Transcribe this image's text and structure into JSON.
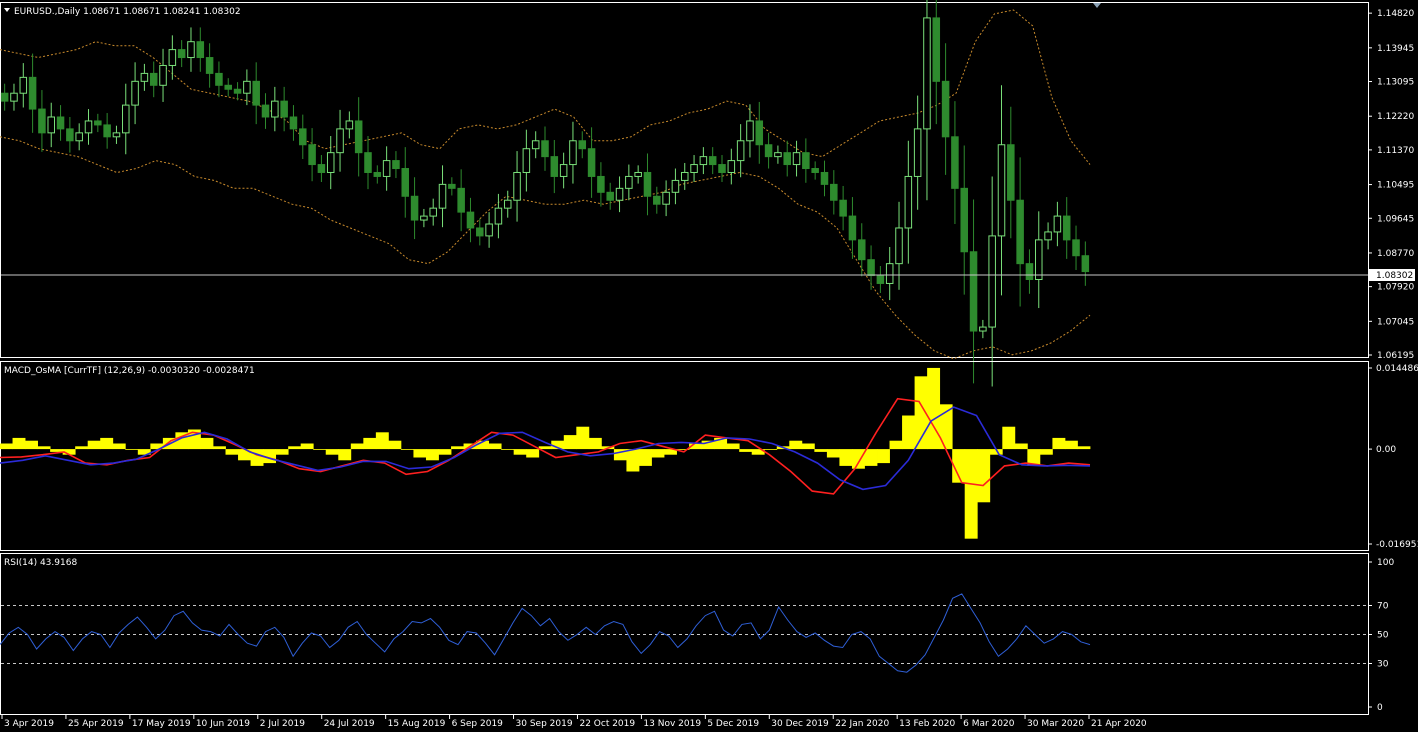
{
  "colors": {
    "background": "#000000",
    "bull": "#7ae07a",
    "bear": "#2e8b2e",
    "bands": "#c88a2c",
    "histogram": "#ffff00",
    "macd_line": "#ff2020",
    "signal_line": "#2b2bd8",
    "rsi_line": "#2f5fd6",
    "frame": "#ffffff"
  },
  "panels": {
    "price": {
      "title": "EURUSD.,Daily  1.08671 1.08671 1.08241 1.08302",
      "menu_icon": "triangle-down-icon",
      "current_price": "1.08302",
      "axis_labels": [
        "1.14820",
        "1.13945",
        "1.13095",
        "1.12220",
        "1.11370",
        "1.10495",
        "1.09645",
        "1.08770",
        "1.07920",
        "1.07045",
        "1.06195"
      ]
    },
    "macd": {
      "title": "MACD_OsMA [CurrTF] (12,26,9) -0.0030320 -0.0028471",
      "axis_labels": [
        "0.0144868",
        "0.00",
        "-0.016951"
      ]
    },
    "rsi": {
      "title": "RSI(14) 43.9168",
      "axis_labels": [
        "100",
        "70",
        "50",
        "30",
        "0"
      ]
    }
  },
  "time_axis": [
    "3 Apr 2019",
    "25 Apr 2019",
    "17 May 2019",
    "10 Jun 2019",
    "2 Jul 2019",
    "24 Jul 2019",
    "15 Aug 2019",
    "6 Sep 2019",
    "30 Sep 2019",
    "22 Oct 2019",
    "13 Nov 2019",
    "5 Dec 2019",
    "30 Dec 2019",
    "22 Jan 2020",
    "13 Feb 2020",
    "6 Mar 2020",
    "30 Mar 2020",
    "21 Apr 2020"
  ],
  "chart_data": [
    {
      "type": "candlestick",
      "title": "EURUSD.,Daily",
      "instrument": "EURUSD.",
      "timeframe": "Daily",
      "last_bar": {
        "open": 1.08671,
        "high": 1.08671,
        "low": 1.08241,
        "close": 1.08302
      },
      "ylim": [
        1.0617,
        1.1495
      ],
      "closes": [
        1.126,
        1.128,
        1.132,
        1.124,
        1.118,
        1.122,
        1.119,
        1.116,
        1.118,
        1.121,
        1.12,
        1.117,
        1.118,
        1.125,
        1.131,
        1.133,
        1.13,
        1.135,
        1.139,
        1.137,
        1.141,
        1.137,
        1.133,
        1.13,
        1.129,
        1.128,
        1.131,
        1.125,
        1.122,
        1.126,
        1.122,
        1.119,
        1.115,
        1.11,
        1.108,
        1.113,
        1.119,
        1.121,
        1.113,
        1.108,
        1.107,
        1.111,
        1.109,
        1.102,
        1.096,
        1.097,
        1.099,
        1.105,
        1.104,
        1.098,
        1.094,
        1.092,
        1.095,
        1.099,
        1.101,
        1.108,
        1.114,
        1.116,
        1.112,
        1.107,
        1.11,
        1.116,
        1.114,
        1.107,
        1.103,
        1.101,
        1.104,
        1.107,
        1.108,
        1.102,
        1.1,
        1.103,
        1.106,
        1.108,
        1.11,
        1.112,
        1.11,
        1.108,
        1.111,
        1.116,
        1.121,
        1.115,
        1.112,
        1.113,
        1.11,
        1.113,
        1.109,
        1.108,
        1.105,
        1.101,
        1.097,
        1.091,
        1.086,
        1.082,
        1.08,
        1.085,
        1.094,
        1.107,
        1.119,
        1.147,
        1.131,
        1.117,
        1.104,
        1.088,
        1.068,
        1.069,
        1.092,
        1.115,
        1.101,
        1.085,
        1.081,
        1.091,
        1.093,
        1.097,
        1.091,
        1.087,
        1.083
      ],
      "upper_band": [
        1.139,
        1.138,
        1.137,
        1.138,
        1.139,
        1.141,
        1.14,
        1.14,
        1.137,
        1.133,
        1.129,
        1.128,
        1.127,
        1.126,
        1.124,
        1.121,
        1.116,
        1.114,
        1.115,
        1.116,
        1.117,
        1.118,
        1.115,
        1.114,
        1.119,
        1.12,
        1.119,
        1.12,
        1.122,
        1.124,
        1.122,
        1.116,
        1.116,
        1.117,
        1.12,
        1.121,
        1.123,
        1.124,
        1.126,
        1.125,
        1.119,
        1.116,
        1.113,
        1.112,
        1.115,
        1.118,
        1.121,
        1.122,
        1.123,
        1.125,
        1.128,
        1.141,
        1.148,
        1.149,
        1.145,
        1.127,
        1.116,
        1.11
      ],
      "lower_band": [
        1.117,
        1.116,
        1.114,
        1.113,
        1.112,
        1.11,
        1.108,
        1.109,
        1.111,
        1.11,
        1.107,
        1.106,
        1.104,
        1.104,
        1.102,
        1.1,
        1.099,
        1.096,
        1.094,
        1.092,
        1.09,
        1.086,
        1.085,
        1.088,
        1.093,
        1.098,
        1.102,
        1.101,
        1.1,
        1.1,
        1.101,
        1.1,
        1.101,
        1.102,
        1.103,
        1.105,
        1.106,
        1.107,
        1.108,
        1.107,
        1.104,
        1.1,
        1.098,
        1.094,
        1.086,
        1.078,
        1.072,
        1.067,
        1.063,
        1.061,
        1.063,
        1.064,
        1.062,
        1.063,
        1.065,
        1.068,
        1.072
      ]
    },
    {
      "type": "histogram_with_lines",
      "title": "MACD_OsMA [CurrTF] (12,26,9)",
      "values_shown": [
        -0.003032,
        -0.0028471
      ],
      "ylim": [
        -0.016951,
        0.0144868
      ],
      "histogram": [
        0.001,
        0.002,
        0.0015,
        0.0005,
        -0.0005,
        -0.001,
        0.0005,
        0.0015,
        0.002,
        0.001,
        0.0,
        -0.001,
        0.001,
        0.002,
        0.003,
        0.0035,
        0.002,
        0.0005,
        -0.001,
        -0.002,
        -0.003,
        -0.0025,
        -0.001,
        0.0005,
        0.001,
        0.0,
        -0.001,
        -0.002,
        0.001,
        0.002,
        0.003,
        0.0015,
        0.0,
        -0.0015,
        -0.002,
        -0.001,
        0.0005,
        0.001,
        0.0015,
        0.001,
        0.0,
        -0.001,
        -0.0015,
        0.0005,
        0.0015,
        0.0025,
        0.004,
        0.002,
        0.0005,
        -0.002,
        -0.004,
        -0.003,
        -0.0015,
        -0.001,
        0.0,
        0.001,
        0.0015,
        0.002,
        0.001,
        -0.0005,
        -0.001,
        0.0,
        0.0005,
        0.0015,
        0.001,
        -0.0005,
        -0.0015,
        -0.003,
        -0.0035,
        -0.003,
        -0.0025,
        0.0015,
        0.006,
        0.013,
        0.0145,
        0.008,
        -0.006,
        -0.016,
        -0.0095,
        -0.001,
        0.004,
        0.001,
        -0.003,
        -0.001,
        0.002,
        0.0015,
        0.0005
      ],
      "macd": [
        -0.0015,
        -0.0014,
        -0.001,
        -0.0005,
        -0.0025,
        -0.0028,
        -0.002,
        -0.0015,
        0.0015,
        0.003,
        0.0025,
        0.0008,
        -0.001,
        -0.002,
        -0.0035,
        -0.004,
        -0.003,
        -0.002,
        -0.0025,
        -0.0045,
        -0.004,
        -0.002,
        0.0005,
        0.003,
        0.0025,
        0.0005,
        -0.0015,
        -0.001,
        -0.0005,
        0.001,
        0.0015,
        0.0005,
        -0.0005,
        0.0025,
        0.002,
        0.0015,
        -0.001,
        -0.004,
        -0.0075,
        -0.008,
        -0.0035,
        0.003,
        0.009,
        0.0085,
        0.002,
        -0.006,
        -0.0065,
        -0.003,
        -0.0025,
        -0.003,
        -0.0025,
        -0.0028
      ],
      "signal": [
        -0.0025,
        -0.002,
        -0.0012,
        -0.002,
        -0.0028,
        -0.0025,
        -0.0018,
        0.0,
        0.002,
        0.003,
        0.0018,
        -0.0005,
        -0.0018,
        -0.0028,
        -0.0038,
        -0.0032,
        -0.0022,
        -0.0022,
        -0.0035,
        -0.0032,
        -0.0015,
        0.0008,
        0.0028,
        0.003,
        0.0012,
        -0.0005,
        -0.0012,
        -0.0008,
        0.0,
        0.001,
        0.0012,
        0.001,
        0.002,
        0.0018,
        0.001,
        -0.0005,
        -0.0025,
        -0.0055,
        -0.0072,
        -0.0065,
        -0.002,
        0.005,
        0.0075,
        0.006,
        -0.001,
        -0.0028,
        -0.003,
        -0.0029,
        -0.003
      ]
    },
    {
      "type": "line",
      "title": "RSI(14)",
      "last_value": 43.9168,
      "ylim": [
        0,
        100
      ],
      "levels": [
        70,
        50,
        30
      ],
      "values": [
        43,
        51,
        55,
        50,
        40,
        47,
        52,
        48,
        39,
        47,
        52,
        50,
        41,
        51,
        57,
        62,
        55,
        47,
        53,
        63,
        66,
        58,
        53,
        52,
        49,
        57,
        50,
        44,
        42,
        52,
        55,
        48,
        35,
        44,
        51,
        49,
        41,
        46,
        55,
        59,
        50,
        44,
        38,
        47,
        52,
        59,
        58,
        61,
        55,
        46,
        43,
        52,
        51,
        44,
        36,
        47,
        58,
        68,
        63,
        56,
        61,
        52,
        46,
        50,
        55,
        50,
        56,
        59,
        57,
        45,
        37,
        43,
        52,
        49,
        41,
        47,
        56,
        63,
        66,
        53,
        49,
        57,
        58,
        47,
        53,
        69,
        60,
        52,
        48,
        51,
        46,
        42,
        41,
        50,
        52,
        47,
        35,
        30,
        25,
        24,
        29,
        36,
        48,
        60,
        75,
        78,
        68,
        58,
        45,
        35,
        40,
        47,
        56,
        50,
        44,
        47,
        52,
        50,
        45,
        43
      ]
    }
  ]
}
